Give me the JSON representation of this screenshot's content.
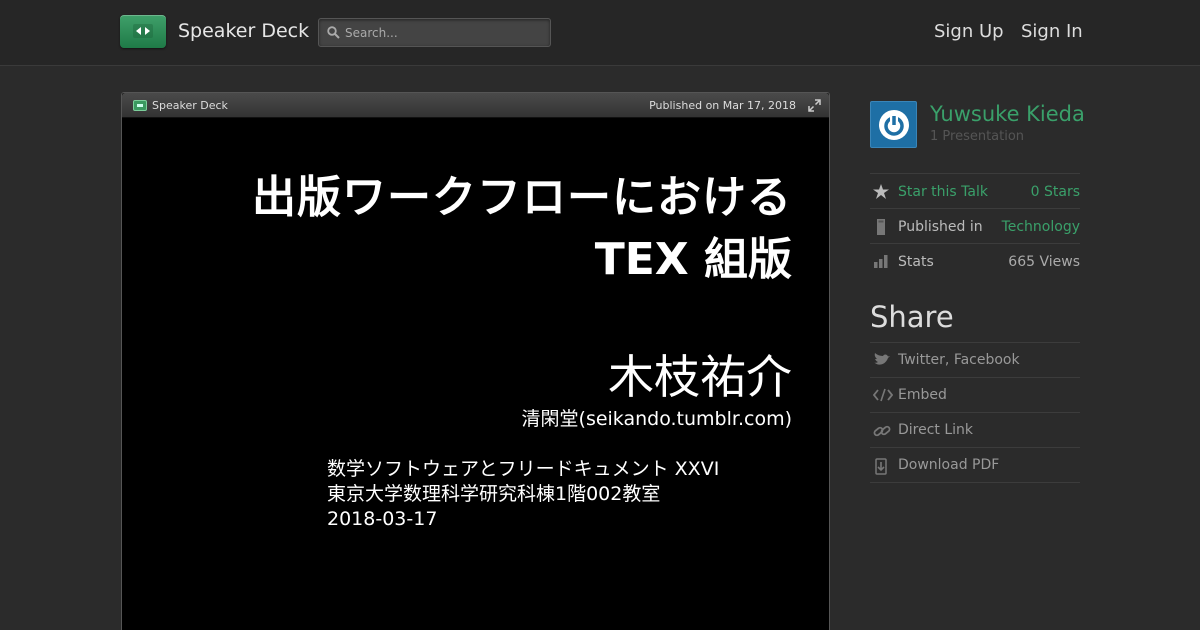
{
  "header": {
    "brand": "Speaker Deck",
    "search_placeholder": "Search...",
    "sign_up": "Sign Up",
    "sign_in": "Sign In",
    "accent": "#2e8b57"
  },
  "player": {
    "brand": "Speaker Deck",
    "published": "Published on Mar 17, 2018"
  },
  "slide": {
    "title_line1": "出版ワークフローにおける",
    "title_line2": "TEX 組版",
    "author": "木枝祐介",
    "affiliation": "清閑堂(seikando.tumblr.com)",
    "event_lines": [
      "数学ソフトウェアとフリードキュメント XXVI",
      "東京大学数理科学研究科棟1階002教室",
      "2018-03-17"
    ]
  },
  "sidebar": {
    "author_name": "Yuwsuke Kieda",
    "author_count": "1 Presentation",
    "stats": [
      {
        "label": "Star this Talk",
        "value": "0 Stars",
        "icon": "star-icon"
      },
      {
        "label": "Published in",
        "value": "Technology",
        "icon": "bookmark-icon"
      },
      {
        "label": "Stats",
        "value": "665 Views",
        "icon": "bar-chart-icon"
      }
    ],
    "share_title": "Share",
    "share": [
      {
        "label": "Twitter, Facebook",
        "icon": "bird-icon"
      },
      {
        "label": "Embed",
        "icon": "code-icon"
      },
      {
        "label": "Direct Link",
        "icon": "link-icon"
      },
      {
        "label": "Download PDF",
        "icon": "download-icon"
      }
    ]
  }
}
